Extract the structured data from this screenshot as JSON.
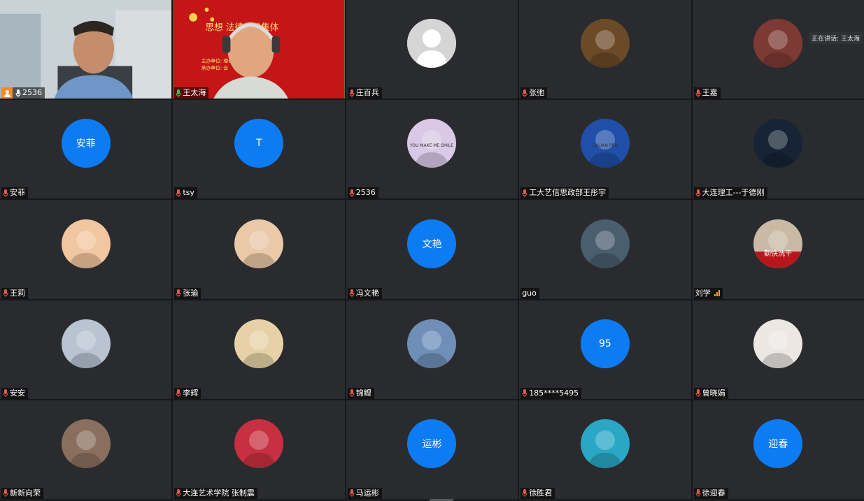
{
  "speaker_tip": "正在讲话: 王太海",
  "banner_title": "思想      法律基础集体",
  "banner_line1": "主办单位:                   理论课教育研究会",
  "banner_line2": "承办单位:                           会",
  "participants": [
    {
      "name": "2536",
      "type": "video1",
      "host": true
    },
    {
      "name": "王太海",
      "type": "video2",
      "speaking": true
    },
    {
      "name": "庄百兵",
      "type": "grey"
    },
    {
      "name": "张弛",
      "type": "photo",
      "color": "#6b4a28"
    },
    {
      "name": "王嘉",
      "type": "photo",
      "color": "#7d3a34"
    },
    {
      "name": "安菲",
      "type": "blue",
      "text": "安菲"
    },
    {
      "name": "tsy",
      "type": "blue",
      "text": "T"
    },
    {
      "name": "2536",
      "type": "photo",
      "color": "#d9c9e6",
      "text": "YOU MAKE ME SMILE"
    },
    {
      "name": "工大艺信思政部王彤宇",
      "type": "photo",
      "color": "#1f4fa8",
      "text": "DALIAN PRO"
    },
    {
      "name": "大连理工---于德刚",
      "type": "photo",
      "color": "#162436"
    },
    {
      "name": "王莉",
      "type": "photo",
      "color": "#f2c6a0"
    },
    {
      "name": "张瑜",
      "type": "photo",
      "color": "#e9c9a7"
    },
    {
      "name": "冯文艳",
      "type": "blue",
      "text": "文艳"
    },
    {
      "name": "guo",
      "type": "photo",
      "color": "#4a5e6e",
      "nomic": true
    },
    {
      "name": "刘学",
      "type": "photo",
      "color": "#c9b9a5",
      "signal": true,
      "nomic": true,
      "text": "勤快洗干"
    },
    {
      "name": "安安",
      "type": "photo",
      "color": "#b8c4d2"
    },
    {
      "name": "李辉",
      "type": "photo",
      "color": "#e6d2a6"
    },
    {
      "name": "锦鲤",
      "type": "photo",
      "color": "#6f8fb8"
    },
    {
      "name": "185****5495",
      "type": "blue",
      "text": "95"
    },
    {
      "name": "曾晓娟",
      "type": "photo",
      "color": "#ece7e3"
    },
    {
      "name": "新新向荣",
      "type": "photo",
      "color": "#8a6f5e"
    },
    {
      "name": "大连艺术学院 张制震",
      "type": "photo",
      "color": "#c73040"
    },
    {
      "name": "马运彬",
      "type": "blue",
      "text": "运彬"
    },
    {
      "name": "徐胜君",
      "type": "photo",
      "color": "#2aa7c4"
    },
    {
      "name": "徐迎春",
      "type": "blue",
      "text": "迎春"
    }
  ]
}
